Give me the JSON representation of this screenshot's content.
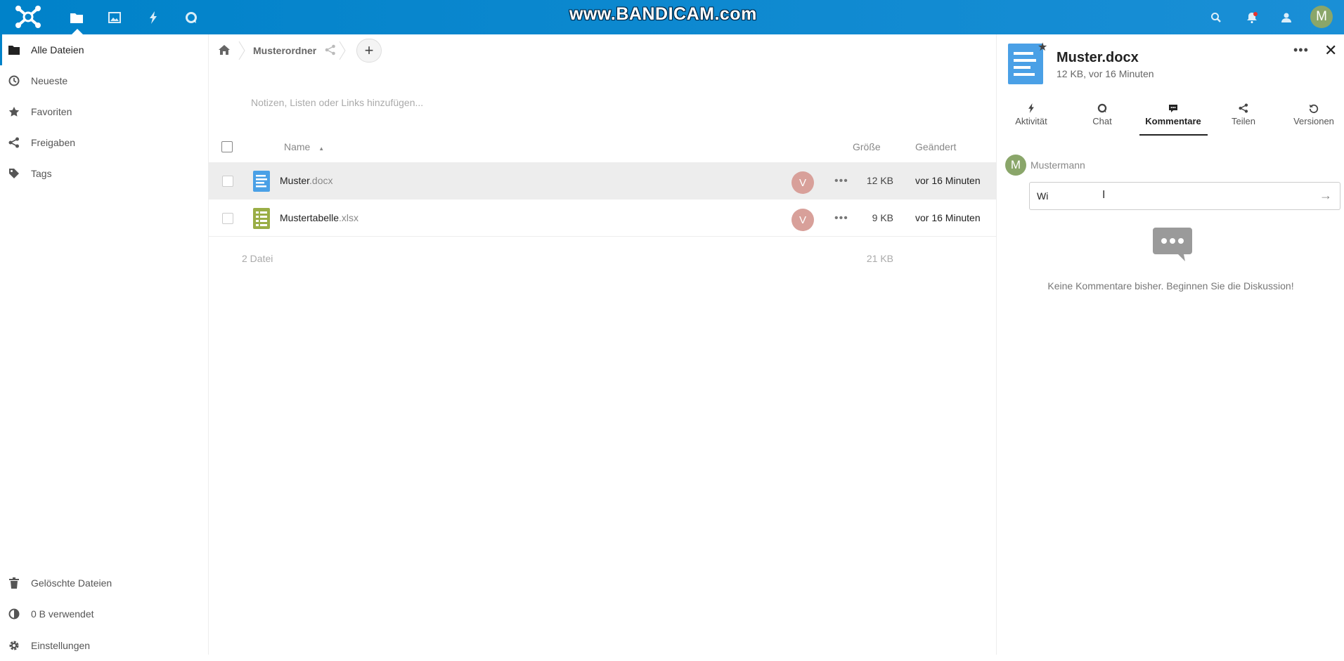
{
  "watermark": "www.BANDICAM.com",
  "header": {
    "apps": [
      {
        "name": "files-icon",
        "active": true
      },
      {
        "name": "photos-icon"
      },
      {
        "name": "activity-icon"
      },
      {
        "name": "talk-icon"
      }
    ],
    "right_icons": [
      "search-icon",
      "notifications-icon",
      "contacts-icon"
    ],
    "user_initial": "M"
  },
  "sidebar": {
    "items": [
      {
        "label": "Alle Dateien",
        "icon": "folder-icon"
      },
      {
        "label": "Neueste",
        "icon": "clock-icon"
      },
      {
        "label": "Favoriten",
        "icon": "star-icon"
      },
      {
        "label": "Freigaben",
        "icon": "share-icon"
      },
      {
        "label": "Tags",
        "icon": "tag-icon"
      }
    ],
    "bottom": [
      {
        "label": "Gelöschte Dateien",
        "icon": "trash-icon"
      },
      {
        "label": "0 B verwendet",
        "icon": "quota-icon"
      },
      {
        "label": "Einstellungen",
        "icon": "gear-icon"
      }
    ]
  },
  "breadcrumb": {
    "folder": "Musterordner",
    "add": "+"
  },
  "notes_placeholder": "Notizen, Listen oder Links hinzufügen...",
  "table": {
    "headers": {
      "name": "Name",
      "size": "Größe",
      "modified": "Geändert"
    },
    "rows": [
      {
        "base": "Muster",
        "ext": ".docx",
        "share_initial": "V",
        "more": "•••",
        "size": "12 KB",
        "modified": "vor 16 Minuten"
      },
      {
        "base": "Mustertabelle",
        "ext": ".xlsx",
        "share_initial": "V",
        "more": "•••",
        "size": "9 KB",
        "modified": "vor 16 Minuten"
      }
    ],
    "summary": {
      "count": "2 Datei",
      "size": "21 KB"
    }
  },
  "panel": {
    "title": "Muster.docx",
    "subtitle": "12 KB, vor 16 Minuten",
    "more": "•••",
    "close": "✕",
    "tabs": [
      {
        "label": "Aktivität",
        "icon": "activity-icon"
      },
      {
        "label": "Chat",
        "icon": "chat-icon"
      },
      {
        "label": "Kommentare",
        "icon": "comment-icon",
        "active": true
      },
      {
        "label": "Teilen",
        "icon": "share-icon"
      },
      {
        "label": "Versionen",
        "icon": "history-icon"
      }
    ],
    "comment": {
      "user_initial": "M",
      "user": "Mustermann",
      "input_value": "Wi",
      "send": "→"
    },
    "empty_message": "Keine Kommentare bisher. Beginnen Sie die Diskussion!"
  },
  "colors": {
    "header": "#0082c9",
    "doc": "#4aa0e6",
    "sheet": "#9aae46",
    "avatar": "#8aa66a",
    "share_avatar": "#d8a09a"
  }
}
